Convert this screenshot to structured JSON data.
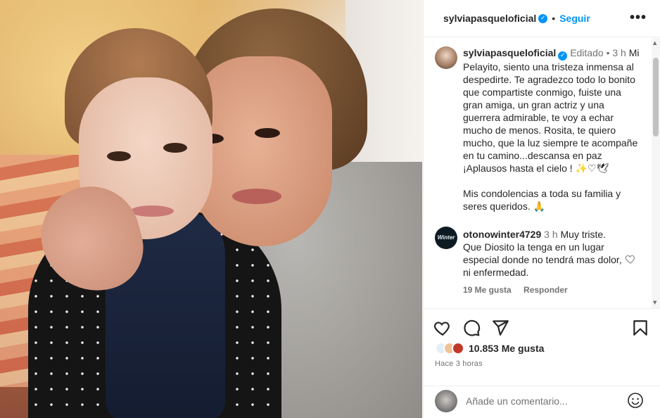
{
  "post": {
    "image_alt": "",
    "author": "sylviapasqueloficial",
    "follow_label": "Seguir",
    "more_label": "•••"
  },
  "caption": {
    "author": "sylviapasqueloficial",
    "edited_label": "Editado",
    "separator": "•",
    "age": "3 h",
    "text": "Mi Pelayito, siento una tristeza inmensa al despedirte. Te agradezco todo lo bonito que compartiste conmigo, fuiste una gran amiga, un gran actriz y una guerrera admirable, te voy a echar mucho de menos. Rosita, te quiero mucho, que la luz siempre te acompañe en tu camino...descansa en paz ¡Aplausos hasta el cielo ! ✨♡🕊",
    "text2": "Mis condolencias a toda su familia y seres queridos. 🙏"
  },
  "comments": [
    {
      "author": "otonowinter4729",
      "age": "3 h",
      "avatar_text": "Winter",
      "text": "Muy triste. Que Diosito la tenga en un lugar especial donde no tendrá mas dolor, ni enfermedad.",
      "likes": "19 Me gusta",
      "reply_label": "Responder"
    }
  ],
  "actions": {
    "like_icon": "heart-icon",
    "comment_icon": "comment-icon",
    "share_icon": "send-icon",
    "save_icon": "bookmark-icon",
    "likes_count": "10.853 Me gusta",
    "timestamp": "Hace 3 horas"
  },
  "comment_input": {
    "placeholder": "Añade un comentario..."
  },
  "colors": {
    "link_blue": "#0095f6",
    "secondary_text": "#737373",
    "border": "#efefef"
  }
}
